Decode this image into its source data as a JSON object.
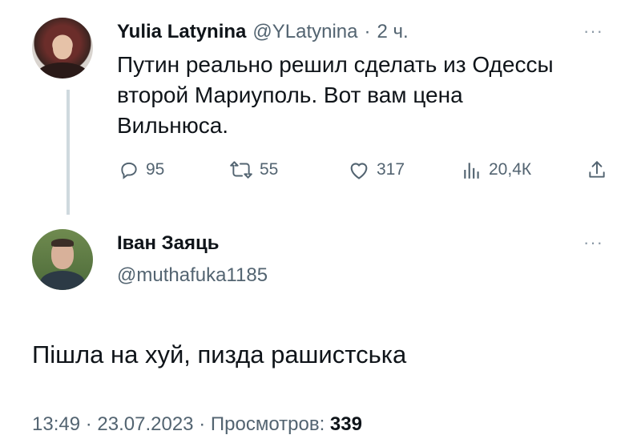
{
  "parent_tweet": {
    "author_name": "Yulia Latynina",
    "author_handle": "@YLatynina",
    "time_sep": "·",
    "time": "2 ч.",
    "more": "···",
    "text_lines": [
      "Путин реально решил сделать из Одессы",
      "второй Мариуполь. Вот вам цена",
      "Вильнюса."
    ],
    "actions": {
      "replies": "95",
      "retweets": "55",
      "likes": "317",
      "views": "20,4К"
    }
  },
  "reply_tweet": {
    "author_name": "Іван Заяць",
    "author_handle": "@muthafuka1185",
    "more": "···",
    "text": "Пішла на хуй, пизда рашистська",
    "meta": {
      "time": "13:49",
      "sep1": "·",
      "date": "23.07.2023",
      "sep2": "·",
      "views_label": "Просмотров:",
      "views_count": "339"
    }
  },
  "colors": {
    "text": "#0f1419",
    "secondary": "#536471",
    "thread_line": "#cfd9de"
  }
}
